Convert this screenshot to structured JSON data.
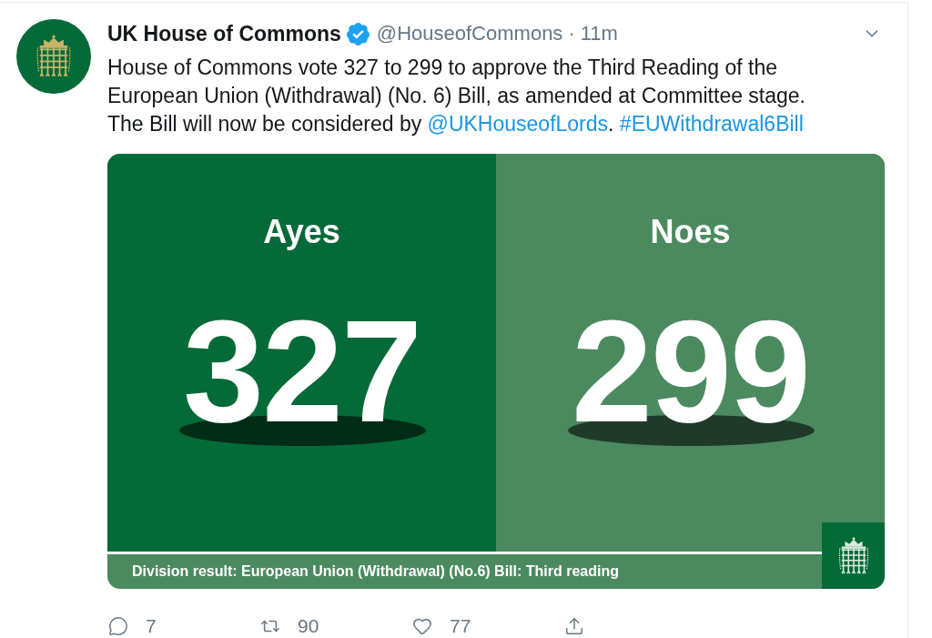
{
  "tweet": {
    "author": {
      "name": "UK House of Commons",
      "verified": true,
      "handle": "@HouseofCommons",
      "separator": "·",
      "time": "11m"
    },
    "text": [
      {
        "kind": "text",
        "text": "House of Commons vote 327 to 299 to approve the Third Reading of the European Union (Withdrawal) (No. 6) Bill, as amended at Committee stage. The Bill will now be considered by "
      },
      {
        "kind": "mention",
        "text": "@UKHouseofLords"
      },
      {
        "kind": "text",
        "text": ". "
      },
      {
        "kind": "hashtag",
        "text": "#EUWithdrawal6Bill"
      }
    ],
    "media": {
      "sides": [
        {
          "label": "Ayes",
          "count": "327",
          "color": "#046a38"
        },
        {
          "label": "Noes",
          "count": "299",
          "color": "#4b8a5f"
        }
      ],
      "caption": "Division result: European Union (Withdrawal) (No.6) Bill: Third reading"
    },
    "actions": [
      {
        "kind": "reply",
        "count": "7"
      },
      {
        "kind": "retweet",
        "count": "90"
      },
      {
        "kind": "like",
        "count": "77"
      },
      {
        "kind": "share"
      }
    ]
  }
}
